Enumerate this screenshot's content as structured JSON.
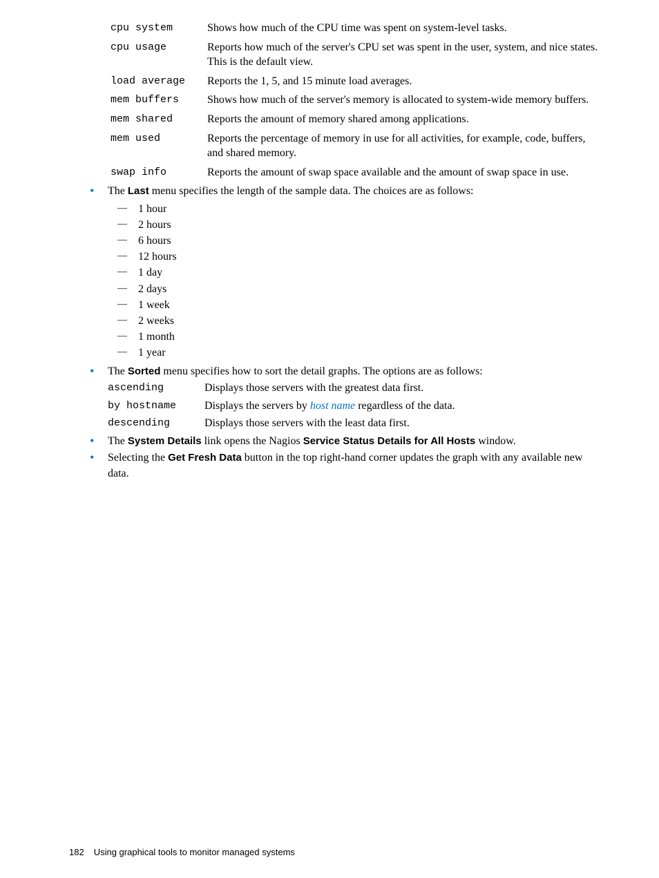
{
  "defs": {
    "cpu_system": {
      "term": "cpu system",
      "desc": "Shows how much of the CPU time was spent on system-level tasks."
    },
    "cpu_usage": {
      "term": "cpu usage",
      "desc": "Reports how much of the server's CPU set was spent in the user, system, and nice states. This is the default view."
    },
    "load_average": {
      "term": "load average",
      "desc": "Reports the 1, 5, and 15 minute load averages."
    },
    "mem_buffers": {
      "term": "mem buffers",
      "desc": "Shows how much of the server's memory is allocated to system-wide memory buffers."
    },
    "mem_shared": {
      "term": "mem shared",
      "desc": "Reports the amount of memory shared among applications."
    },
    "mem_used": {
      "term": "mem used",
      "desc": "Reports the percentage of memory in use for all activities, for example, code, buffers, and shared memory."
    },
    "swap_info": {
      "term": "swap info",
      "desc": "Reports the amount of swap space available and the amount of swap space in use."
    }
  },
  "last_menu": {
    "intro_pre": "The ",
    "intro_bold": "Last",
    "intro_post": " menu specifies the length of the sample data. The choices are as follows:",
    "items": [
      "1 hour",
      "2 hours",
      "6 hours",
      "12 hours",
      "1 day",
      "2 days",
      "1 week",
      "2 weeks",
      "1 month",
      "1 year"
    ]
  },
  "sorted_menu": {
    "intro_pre": "The ",
    "intro_bold": "Sorted",
    "intro_post": " menu specifies how to sort the detail graphs. The options are as follows:",
    "ascending": {
      "term": "ascending",
      "desc": "Displays those servers with the greatest data first."
    },
    "by_hostname": {
      "term": "by hostname",
      "desc_pre": "Displays the servers by ",
      "link": "host name",
      "desc_post": " regardless of the data."
    },
    "descending": {
      "term": "descending",
      "desc": "Displays those servers with the least data first."
    }
  },
  "system_details": {
    "pre": "The ",
    "bold1": "System Details",
    "mid": " link opens the Nagios ",
    "bold2": "Service Status Details for All Hosts",
    "post": " window."
  },
  "get_fresh": {
    "pre": "Selecting the ",
    "bold": "Get Fresh Data",
    "post": " button in the top right-hand corner updates the graph with any available new data."
  },
  "footer": {
    "page": "182",
    "text": "Using graphical tools to monitor managed systems"
  }
}
